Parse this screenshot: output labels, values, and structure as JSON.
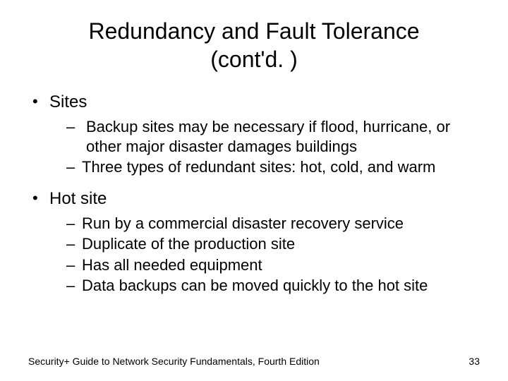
{
  "slide": {
    "title_line1": "Redundancy and Fault Tolerance",
    "title_line2": "(cont'd. )",
    "bullets": [
      {
        "label": "Sites",
        "sub": [
          " Backup sites may be necessary if flood, hurricane, or other major disaster damages buildings",
          "Three types of redundant sites: hot, cold, and warm"
        ]
      },
      {
        "label": "Hot site",
        "sub": [
          "Run by a commercial disaster recovery service",
          "Duplicate of the production site",
          "Has all needed equipment",
          "Data backups can be moved quickly to the hot site"
        ]
      }
    ],
    "footer_text": "Security+ Guide to Network Security Fundamentals, Fourth Edition",
    "page_number": "33"
  }
}
